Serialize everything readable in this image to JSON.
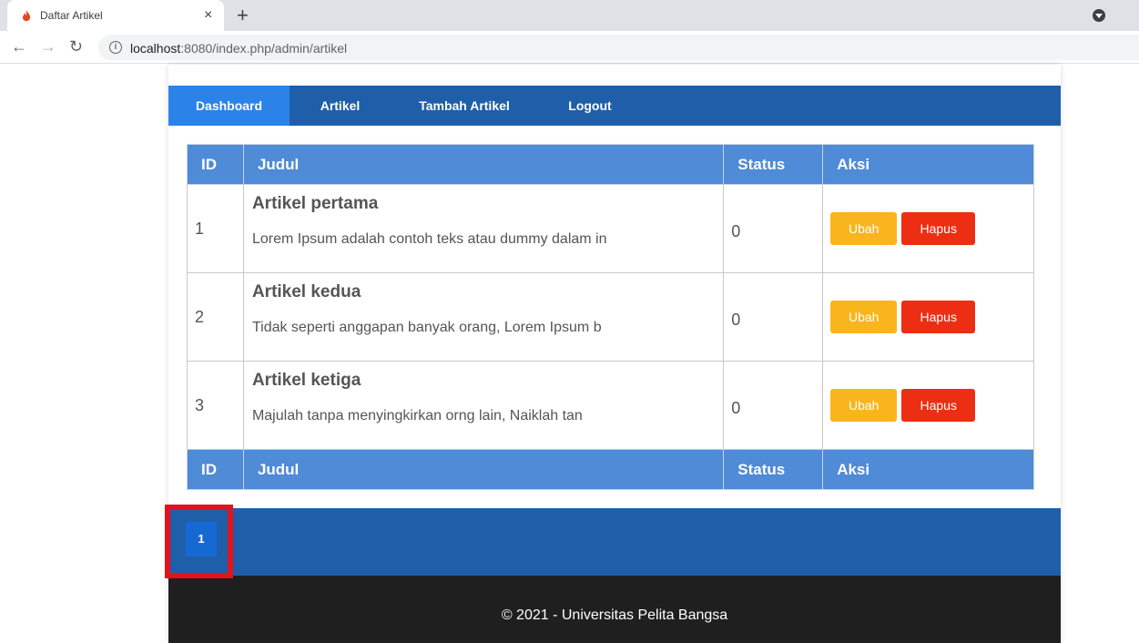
{
  "browser": {
    "tab_title": "Daftar Artikel",
    "tab_close": "×",
    "new_tab": "+",
    "url_host": "localhost",
    "url_rest": ":8080/index.php/admin/artikel"
  },
  "menu": {
    "items": [
      {
        "label": "Dashboard",
        "active": true
      },
      {
        "label": "Artikel"
      },
      {
        "label": "Tambah Artikel"
      },
      {
        "label": "Logout"
      }
    ]
  },
  "table": {
    "headers": [
      "ID",
      "Judul",
      "Status",
      "Aksi"
    ],
    "rows": [
      {
        "id": "1",
        "title": "Artikel pertama",
        "excerpt": "Lorem Ipsum adalah contoh teks atau dummy dalam in",
        "status": "0"
      },
      {
        "id": "2",
        "title": "Artikel kedua",
        "excerpt": "Tidak seperti anggapan banyak orang, Lorem Ipsum b",
        "status": "0"
      },
      {
        "id": "3",
        "title": "Artikel ketiga",
        "excerpt": "Majulah tanpa menyingkirkan orng lain, Naiklah tan",
        "status": "0"
      }
    ],
    "edit_label": "Ubah",
    "delete_label": "Hapus"
  },
  "pagination": {
    "current_page": "1"
  },
  "footer": {
    "text": "© 2021 - Universitas Pelita Bangsa"
  },
  "colors": {
    "nav": "#1f5faa",
    "nav_active": "#2b83ea",
    "table_header": "#4f8bd6",
    "btn_edit": "#f8b51e",
    "btn_delete": "#ec2f13",
    "highlight": "#e5121c",
    "footer": "#1f1f1f"
  }
}
